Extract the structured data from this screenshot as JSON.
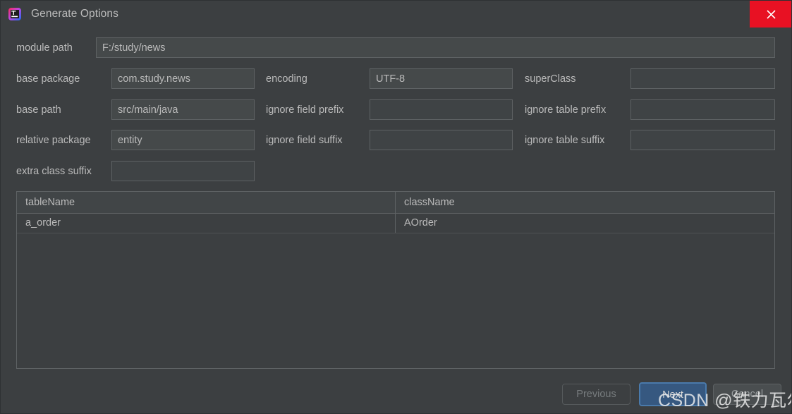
{
  "window": {
    "title": "Generate Options",
    "app_icon": "intellij-idea-icon",
    "close_label": "×",
    "accent_blue": "#365880",
    "close_red": "#e81123",
    "background": "#3c3f41"
  },
  "form": {
    "module_path": {
      "label": "module path",
      "value": "F:/study/news",
      "placeholder": ""
    },
    "base_package": {
      "label": "base package",
      "value": "com.study.news",
      "placeholder": ""
    },
    "base_path": {
      "label": "base path",
      "value": "src/main/java",
      "placeholder": ""
    },
    "relative_package": {
      "label": "relative package",
      "value": "entity",
      "placeholder": ""
    },
    "extra_class_suffix": {
      "label": "extra class suffix",
      "value": "",
      "placeholder": ""
    },
    "encoding": {
      "label": "encoding",
      "value": "UTF-8",
      "placeholder": ""
    },
    "ignore_field_prefix": {
      "label": "ignore field prefix",
      "value": "",
      "placeholder": ""
    },
    "ignore_field_suffix": {
      "label": "ignore field suffix",
      "value": "",
      "placeholder": ""
    },
    "super_class": {
      "label": "superClass",
      "value": "",
      "placeholder": ""
    },
    "ignore_table_prefix": {
      "label": "ignore table prefix",
      "value": "",
      "placeholder": ""
    },
    "ignore_table_suffix": {
      "label": "ignore table suffix",
      "value": "",
      "placeholder": ""
    }
  },
  "table": {
    "columns": [
      "tableName",
      "className"
    ],
    "rows": [
      {
        "tableName": "a_order",
        "className": "AOrder"
      }
    ]
  },
  "buttons": {
    "previous": "Previous",
    "next": "Next",
    "cancel": "Cancel"
  },
  "watermark": {
    "text": "CSDN @铁力瓦尔良"
  }
}
